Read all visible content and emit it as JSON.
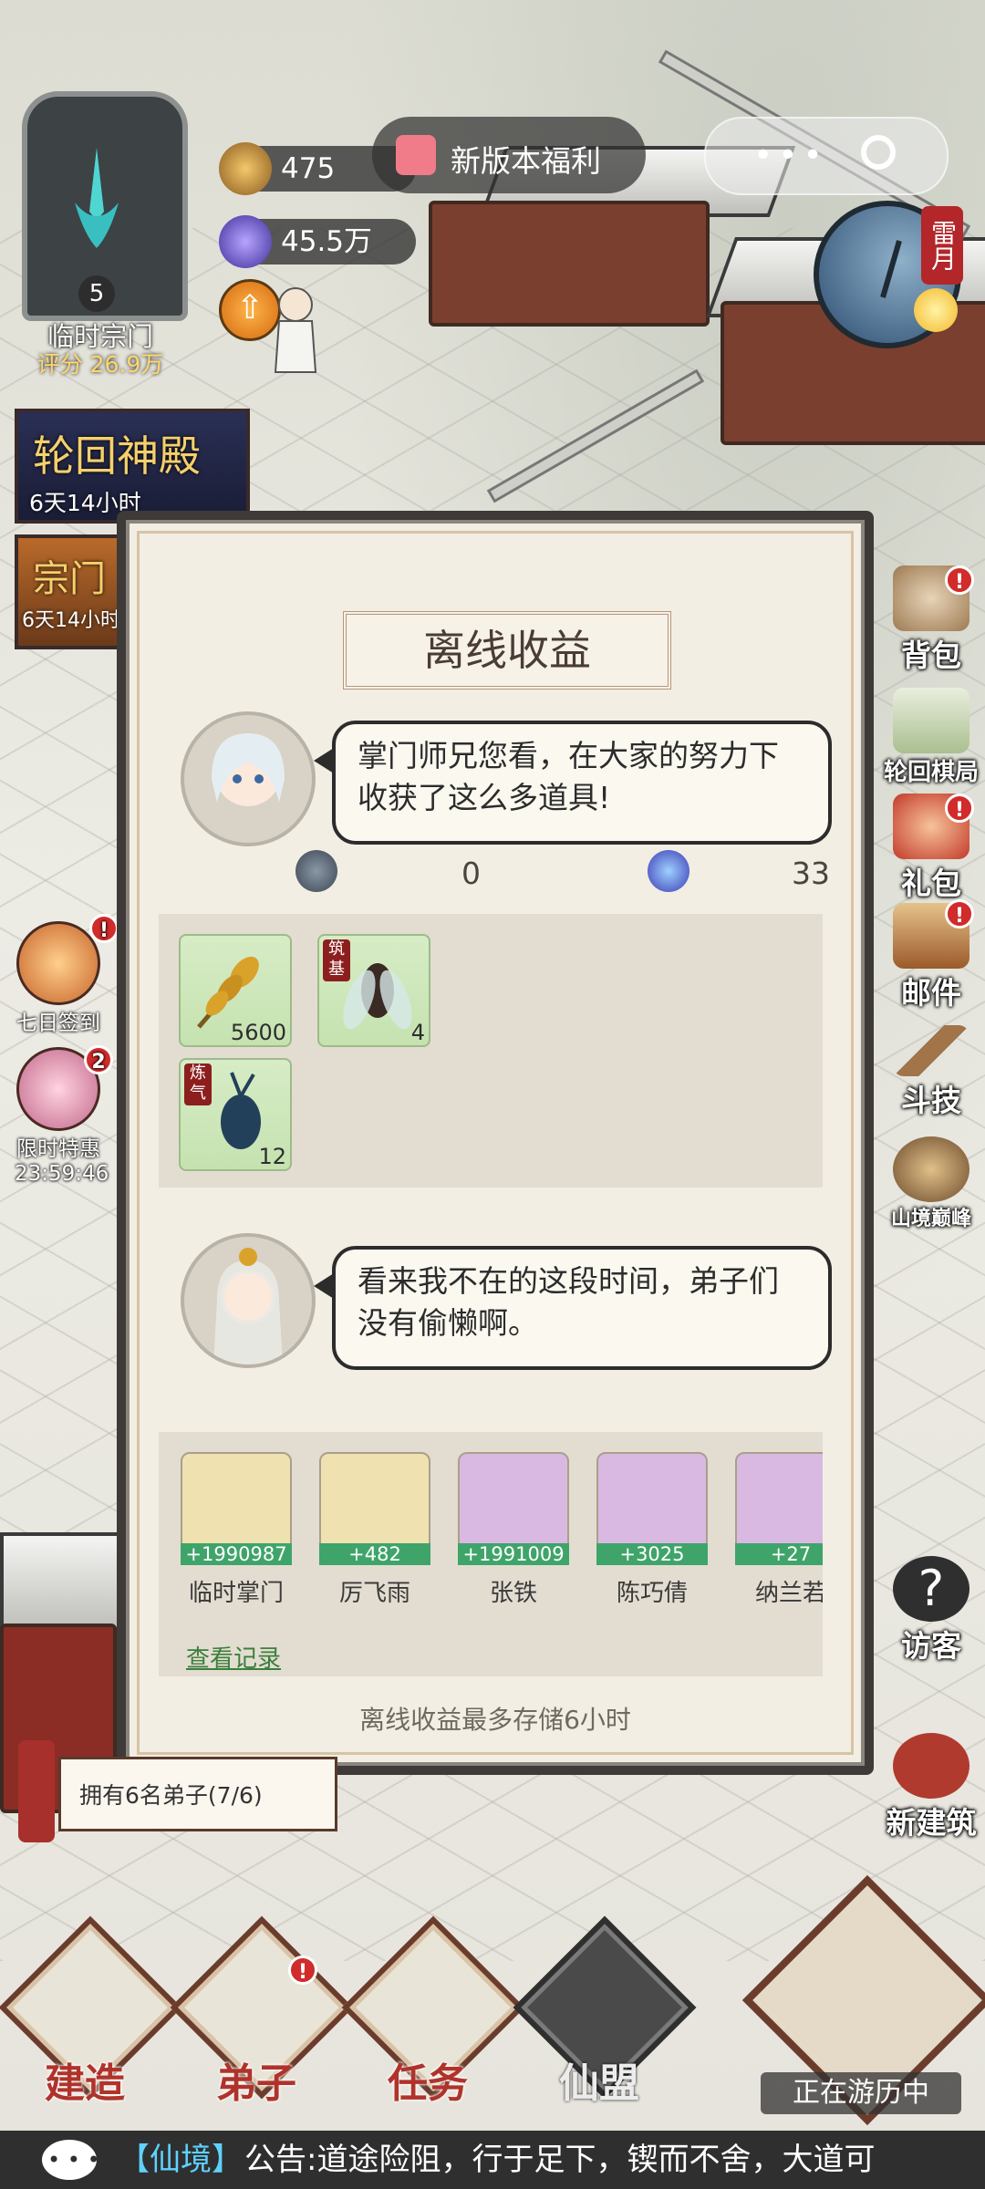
{
  "hud": {
    "sect_level": "5",
    "sect_name": "临时宗门",
    "sect_score": "评分 26.9万",
    "currency_1": "475",
    "currency_2": "45.5万",
    "welfare_label": "新版本福利",
    "month_tag": "雷月"
  },
  "events": [
    {
      "title": "轮回神殿",
      "time": "6天14小时"
    },
    {
      "title": "宗门",
      "time": "6天14小时"
    }
  ],
  "left_buttons": [
    {
      "label": "七日签到",
      "badge": "!"
    },
    {
      "label": "限时特惠",
      "timer": "23:59:46",
      "badge": "2"
    }
  ],
  "right_buttons": [
    {
      "label": "背包",
      "badge": "!"
    },
    {
      "label": "轮回棋局"
    },
    {
      "label": "礼包",
      "badge": "!"
    },
    {
      "label": "邮件",
      "badge": "!"
    },
    {
      "label": "斗技"
    },
    {
      "label": "山境巅峰"
    },
    {
      "label": "访客"
    },
    {
      "label": "新建筑"
    }
  ],
  "modal": {
    "title": "离线收益",
    "speech_1": "掌门师兄您看，在大家的努力下收获了这么多道具!",
    "summary_1": "0",
    "summary_2": "33",
    "items": [
      {
        "name": "grain-item",
        "qty": "5600"
      },
      {
        "name": "cicada-item",
        "qty": "4",
        "tag": "筑基"
      },
      {
        "name": "beetle-item",
        "qty": "12",
        "tag": "炼气"
      }
    ],
    "speech_2": "看来我不在的这段时间，弟子们没有偷懒啊。",
    "disciples": [
      {
        "name": "临时掌门",
        "gain": "+1990987",
        "bg": "#efe2b0"
      },
      {
        "name": "厉飞雨",
        "gain": "+482",
        "bg": "#efe2b0"
      },
      {
        "name": "张铁",
        "gain": "+1991009",
        "bg": "#d9b9e2"
      },
      {
        "name": "陈巧倩",
        "gain": "+3025",
        "bg": "#d9b9e2"
      },
      {
        "name": "纳兰若",
        "gain": "+27",
        "bg": "#d9b9e2"
      }
    ],
    "view_record": "查看记录",
    "footer": "离线收益最多存储6小时"
  },
  "disciple_count": "拥有6名弟子(7/6)",
  "nav": [
    {
      "label": "建造"
    },
    {
      "label": "弟子",
      "badge": "!"
    },
    {
      "label": "任务"
    },
    {
      "label": "仙盟"
    }
  ],
  "journey_status": "正在游历中",
  "ticker": {
    "channel": "【仙境】",
    "message": "公告:道途险阻，行于足下，锲而不舍，大道可"
  }
}
